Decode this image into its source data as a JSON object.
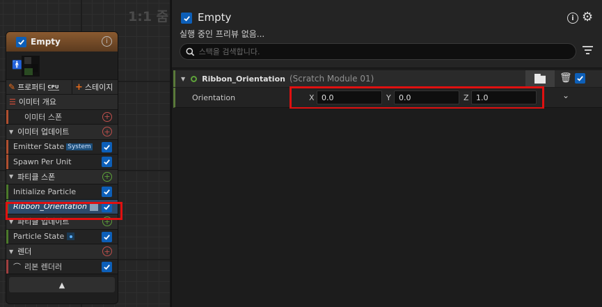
{
  "graph": {
    "zoom_label": "1:1 줌",
    "node": {
      "title": "Empty",
      "tabs": {
        "properties": "프로퍼티",
        "sim_target": "CPU",
        "stage": "스테이지"
      },
      "rows": [
        {
          "kind": "section",
          "label": "이미터 개요"
        },
        {
          "kind": "module",
          "label": "이미터 스폰",
          "action": "add",
          "action_color": "red"
        },
        {
          "kind": "section",
          "label": "이미터 업데이트",
          "action": "add",
          "action_color": "red"
        },
        {
          "kind": "module",
          "label": "Emitter State",
          "tag": "System",
          "checked": true
        },
        {
          "kind": "module",
          "label": "Spawn Per Unit",
          "checked": true
        },
        {
          "kind": "section",
          "label": "파티클 스폰",
          "action": "add",
          "action_color": "green"
        },
        {
          "kind": "module",
          "label": "Initialize Particle",
          "checked": true
        },
        {
          "kind": "module",
          "label": "Ribbon_Orientation",
          "checked": true,
          "selected": true
        },
        {
          "kind": "section",
          "label": "파티클 업데이트",
          "action": "add",
          "action_color": "green"
        },
        {
          "kind": "module",
          "label": "Particle State",
          "checked": true
        },
        {
          "kind": "section",
          "label": "렌더",
          "action": "add",
          "action_color": "red"
        },
        {
          "kind": "module",
          "label": "리본 렌더러",
          "checked": true
        }
      ],
      "footer_icon": "chevron-up-icon"
    }
  },
  "panel": {
    "emitter_name": "Empty",
    "emitter_enabled": true,
    "preview_status": "실행 중인 프리뷰 없음...",
    "search_placeholder": "스택을 검색합니다.",
    "module": {
      "name": "Ribbon_Orientation",
      "source": "(Scratch Module 01)",
      "enabled": true
    },
    "parameter": {
      "label": "Orientation",
      "x_label": "X",
      "x_value": "0.0",
      "y_label": "Y",
      "y_value": "0.0",
      "z_label": "Z",
      "z_value": "1.0"
    }
  },
  "colors": {
    "accent_blue": "#0d5fb8",
    "highlight_red": "#e01010",
    "emitter_header": "#8a5a30",
    "spawn_green": "#5ea33a",
    "add_red": "#c0504d"
  }
}
